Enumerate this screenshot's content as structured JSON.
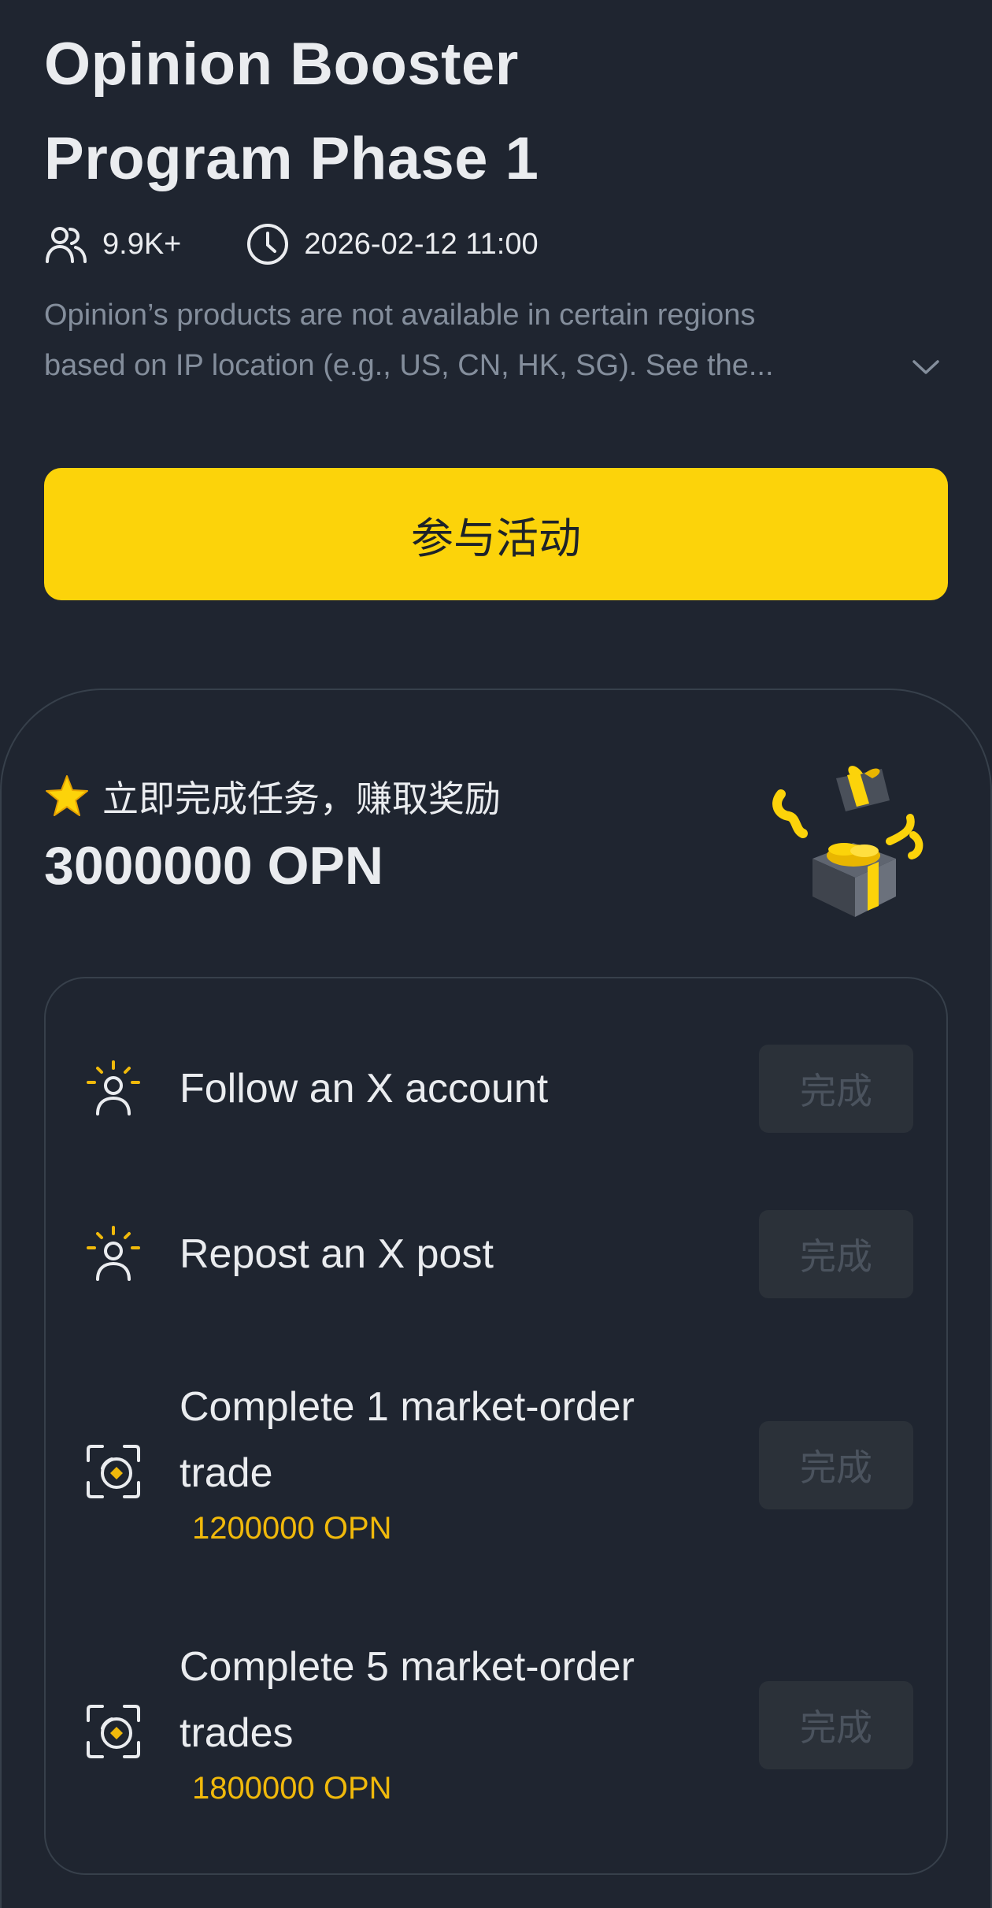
{
  "campaign": {
    "title_line1": "Opinion Booster",
    "title_line2": "Program Phase 1",
    "participants": "9.9K+",
    "end_time": "2026-02-12 11:00",
    "notice_line1": "Opinion’s products are not available in certain regions",
    "notice_line2": "based on IP location (e.g., US, CN, HK, SG). See the...",
    "join_label": "参与活动"
  },
  "reward": {
    "subtitle": "立即完成任务，赚取奖励",
    "amount": "3000000 OPN"
  },
  "tasks": [
    {
      "title": "Follow an X account",
      "reward": "",
      "button": "完成",
      "icon": "person-sparkle-icon"
    },
    {
      "title": "Repost an X post",
      "reward": "",
      "button": "完成",
      "icon": "person-sparkle-icon"
    },
    {
      "title_line1": "Complete 1 market-order",
      "title_line2": "trade",
      "reward": "1200000 OPN",
      "button": "完成",
      "icon": "trade-scan-icon"
    },
    {
      "title_line1": "Complete 5 market-order",
      "title_line2": "trades",
      "reward": "1800000 OPN",
      "button": "完成",
      "icon": "trade-scan-icon"
    }
  ],
  "colors": {
    "background": "#1f2530",
    "accent": "#fcd30a",
    "reward_text": "#f0b90b",
    "muted_text": "#848e9c",
    "disabled_button": "#2b3139"
  }
}
